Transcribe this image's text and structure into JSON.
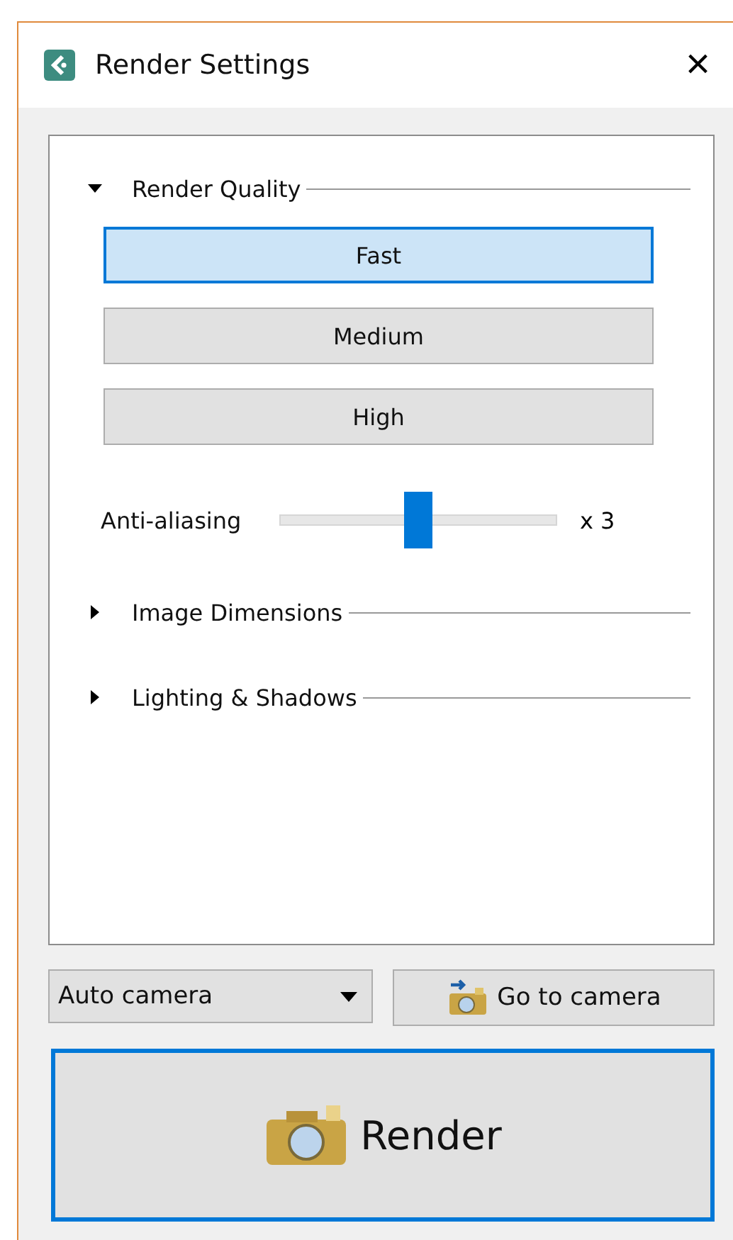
{
  "window": {
    "title": "Render Settings",
    "close": "×"
  },
  "sections": [
    {
      "title": "Render Quality",
      "expanded": true,
      "options": [
        {
          "label": "Fast",
          "selected": true
        },
        {
          "label": "Medium",
          "selected": false
        },
        {
          "label": "High",
          "selected": false
        }
      ],
      "slider": {
        "label": "Anti-aliasing",
        "level": 0.5,
        "reading": "x 3"
      }
    },
    {
      "title": "Image Dimensions",
      "expanded": false
    },
    {
      "title": "Lighting & Shadows",
      "expanded": false
    }
  ],
  "camera_select": {
    "value": "Auto camera"
  },
  "go_button": {
    "label": "Go to camera"
  },
  "render_button": {
    "label": "Render",
    "focused": true
  }
}
